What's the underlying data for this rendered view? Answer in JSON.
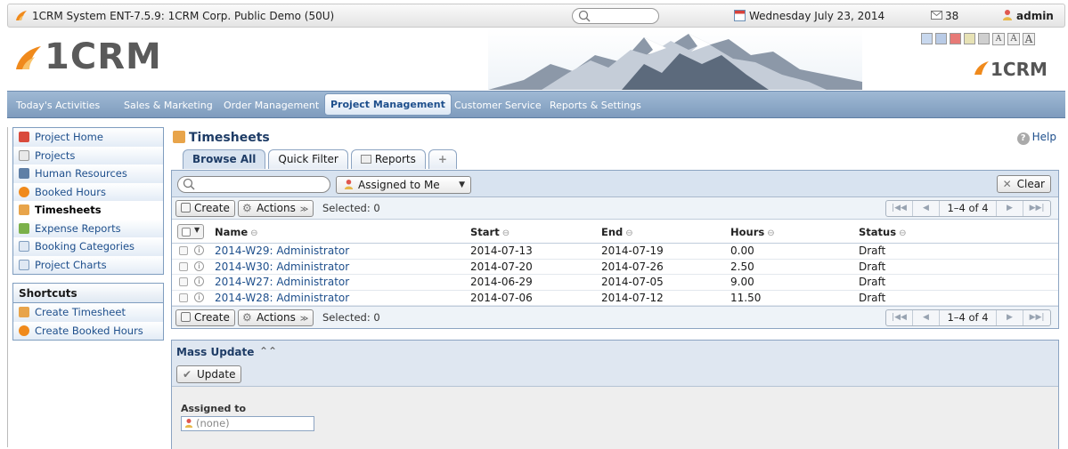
{
  "window": {
    "title": "1CRM System ENT-7.5.9: 1CRM Corp. Public Demo (50U)",
    "date": "Wednesday July 23, 2014",
    "mail_count": "38",
    "user": "admin"
  },
  "header": {
    "logo_text": "1CRM",
    "small_logo_text": "1CRM",
    "font_buttons": [
      "A",
      "A",
      "A"
    ],
    "theme_colors": [
      "#c8d8ee",
      "#b9cbe6",
      "#e77a77",
      "#e7e2b5",
      "#cfcfcf"
    ]
  },
  "nav": {
    "items": [
      {
        "label": "Today's Activities"
      },
      {
        "label": "Sales & Marketing"
      },
      {
        "label": "Order Management"
      },
      {
        "label": "Project Management",
        "active": true
      },
      {
        "label": "Customer Service"
      },
      {
        "label": "Reports & Settings"
      }
    ]
  },
  "sidebar": {
    "items": [
      {
        "label": "Project Home",
        "icon": "home-icon"
      },
      {
        "label": "Projects",
        "icon": "project-icon"
      },
      {
        "label": "Human Resources",
        "icon": "human-resources-icon"
      },
      {
        "label": "Booked Hours",
        "icon": "clock-icon"
      },
      {
        "label": "Timesheets",
        "icon": "timesheet-icon",
        "active": true
      },
      {
        "label": "Expense Reports",
        "icon": "expense-icon"
      },
      {
        "label": "Booking Categories",
        "icon": "category-icon"
      },
      {
        "label": "Project Charts",
        "icon": "chart-icon"
      }
    ],
    "shortcuts_title": "Shortcuts",
    "shortcuts": [
      {
        "label": "Create Timesheet",
        "icon": "timesheet-add-icon"
      },
      {
        "label": "Create Booked Hours",
        "icon": "clock-add-icon"
      }
    ]
  },
  "main": {
    "title": "Timesheets",
    "help": "Help",
    "tabs": [
      {
        "label": "Browse All",
        "active": true
      },
      {
        "label": "Quick Filter"
      },
      {
        "label": "Reports"
      },
      {
        "label": "+"
      }
    ],
    "filter": {
      "search_placeholder": "",
      "assigned": "Assigned to Me",
      "clear": "Clear"
    },
    "toolbar": {
      "create": "Create",
      "actions": "Actions",
      "selected": "Selected: 0",
      "range": "1–4 of 4"
    },
    "columns": [
      "Name",
      "Start",
      "End",
      "Hours",
      "Status"
    ],
    "rows": [
      {
        "name": "2014-W29: Administrator",
        "start": "2014-07-13",
        "end": "2014-07-19",
        "hours": "0.00",
        "status": "Draft"
      },
      {
        "name": "2014-W30: Administrator",
        "start": "2014-07-20",
        "end": "2014-07-26",
        "hours": "2.50",
        "status": "Draft"
      },
      {
        "name": "2014-W27: Administrator",
        "start": "2014-06-29",
        "end": "2014-07-05",
        "hours": "9.00",
        "status": "Draft"
      },
      {
        "name": "2014-W28: Administrator",
        "start": "2014-07-06",
        "end": "2014-07-12",
        "hours": "11.50",
        "status": "Draft"
      }
    ],
    "mass_update": {
      "title": "Mass Update",
      "update": "Update",
      "assigned_label": "Assigned to",
      "assigned_value": "(none)"
    }
  },
  "colors": {
    "nav_bg": "#8aa6c6",
    "link": "#1e4f8c",
    "panel_bg": "#d8e3f0"
  }
}
